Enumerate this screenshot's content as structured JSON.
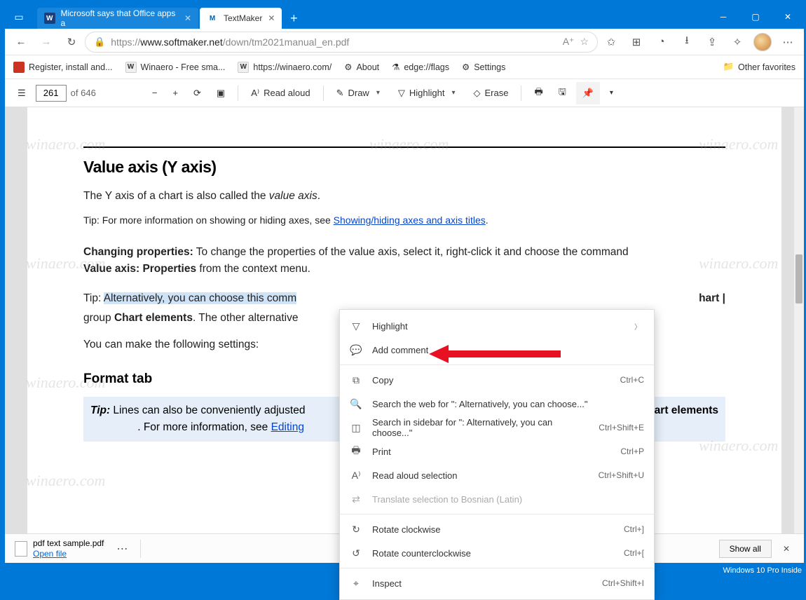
{
  "tabs": [
    {
      "label": "Microsoft says that Office apps a"
    },
    {
      "label": "TextMaker"
    }
  ],
  "url": {
    "gray1": "https://",
    "black": "www.softmaker.net",
    "gray2": "/down/tm2021manual_en.pdf"
  },
  "bookmarks": {
    "b0": "Register, install and...",
    "b1": "Winaero - Free sma...",
    "b2": "https://winaero.com/",
    "b3": "About",
    "b4": "edge://flags",
    "b5": "Settings",
    "other": "Other favorites"
  },
  "pdfbar": {
    "page": "261",
    "of": "of 646",
    "read": "Read aloud",
    "draw": "Draw",
    "hl": "Highlight",
    "erase": "Erase"
  },
  "doc": {
    "h1": "Value axis (Y axis)",
    "p1a": "The Y axis of a chart is also called the ",
    "p1b": "value axis",
    "p1c": ".",
    "tip1a": "Tip: For more information on showing or hiding axes, see  ",
    "tip1link": "Showing/hiding axes and axis titles",
    "tip1b": ".",
    "chp": "Changing properties:",
    "chp_rest": " To change the properties of the value axis, select it, right-click it and choose the command ",
    "chp2": "Value axis: Properties",
    "chp2_rest": " from the context menu.",
    "alt_pre": "Tip: ",
    "alt_sel": "Alternatively, you can choose this comm",
    "alt_tail": "hart |",
    "alt2a": "group ",
    "alt2b": "Chart elements",
    "alt2c": ". The other alternative",
    "follow": "You can make the following settings:",
    "h2": "Format tab",
    "box_tip": "Tip:",
    "box_a": " Lines can also be conveniently adjusted",
    "box_b": "Chart elements",
    "box_c": ". For more information, see ",
    "box_link": "Editing"
  },
  "ctx": {
    "highlight": "Highlight",
    "addc": "Add comment",
    "copy": "Copy",
    "copy_sc": "Ctrl+C",
    "search": "Search the web for \": Alternatively, you can choose...\"",
    "sidebar": "Search in sidebar for \": Alternatively, you can choose...\"",
    "sidebar_sc": "Ctrl+Shift+E",
    "print": "Print",
    "print_sc": "Ctrl+P",
    "read": "Read aloud selection",
    "read_sc": "Ctrl+Shift+U",
    "translate": "Translate selection to Bosnian (Latin)",
    "rotcw": "Rotate clockwise",
    "rotcw_sc": "Ctrl+]",
    "rotccw": "Rotate counterclockwise",
    "rotccw_sc": "Ctrl+[",
    "inspect": "Inspect",
    "inspect_sc": "Ctrl+Shift+I"
  },
  "dl": {
    "file": "pdf text sample.pdf",
    "open": "Open file",
    "showall": "Show all"
  },
  "sys": "Windows 10 Pro Inside",
  "watermark": "winaero.com"
}
